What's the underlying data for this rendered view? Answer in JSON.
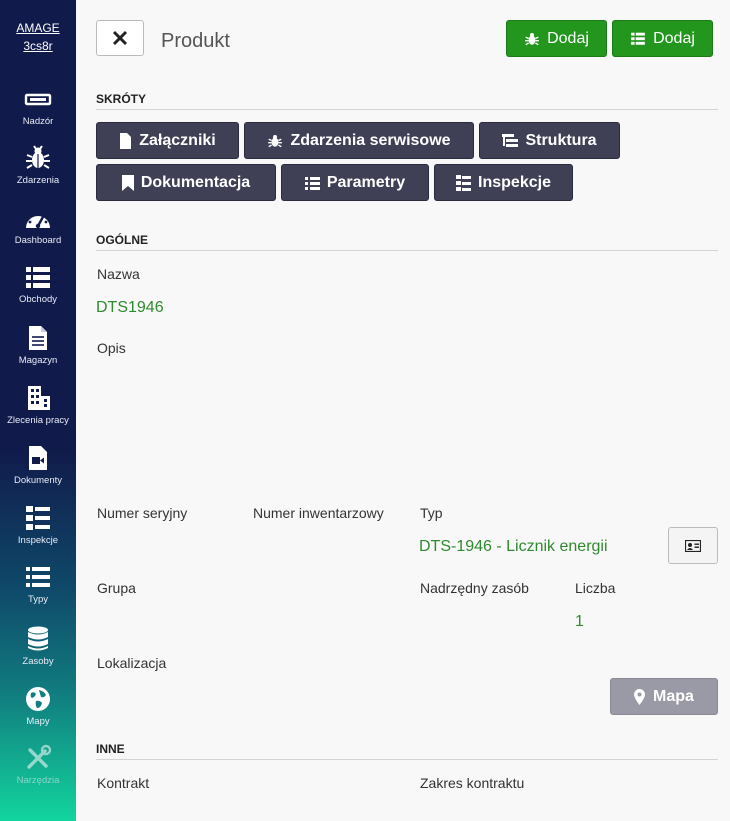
{
  "sidebar": {
    "brand_line1": "AMAGE",
    "brand_line2": "3cs8r",
    "items": [
      {
        "label": "Nadzór",
        "icon": "monitor-icon"
      },
      {
        "label": "Zdarzenia",
        "icon": "bug-icon"
      },
      {
        "label": "Dashboard",
        "icon": "gauge-icon"
      },
      {
        "label": "Obchody",
        "icon": "list-icon"
      },
      {
        "label": "Magazyn",
        "icon": "document-icon"
      },
      {
        "label": "Zlecenia pracy",
        "icon": "building-icon"
      },
      {
        "label": "Dokumenty",
        "icon": "video-file-icon"
      },
      {
        "label": "Inspekcje",
        "icon": "checklist-icon"
      },
      {
        "label": "Typy",
        "icon": "list-icon"
      },
      {
        "label": "Zasoby",
        "icon": "database-icon"
      },
      {
        "label": "Mapy",
        "icon": "globe-icon"
      },
      {
        "label": "Narzędzia",
        "icon": "tools-icon"
      }
    ]
  },
  "header": {
    "title": "Produkt",
    "add_event_label": "Dodaj",
    "add_list_label": "Dodaj"
  },
  "shortcuts": {
    "title": "SKRÓTY",
    "buttons": [
      {
        "label": "Załączniki",
        "icon": "file-icon"
      },
      {
        "label": "Zdarzenia serwisowe",
        "icon": "bug-icon"
      },
      {
        "label": "Struktura",
        "icon": "structure-icon"
      },
      {
        "label": "Dokumentacja",
        "icon": "bookmark-icon"
      },
      {
        "label": "Parametry",
        "icon": "list-icon"
      },
      {
        "label": "Inspekcje",
        "icon": "checklist-icon"
      }
    ]
  },
  "general": {
    "title": "OGÓLNE",
    "name_label": "Nazwa",
    "name_value": "DTS1946",
    "description_label": "Opis",
    "serial_label": "Numer seryjny",
    "inventory_label": "Numer inwentarzowy",
    "type_label": "Typ",
    "type_value": "DTS-1946 - Licznik energii",
    "group_label": "Grupa",
    "parent_label": "Nadrzędny zasób",
    "count_label": "Liczba",
    "count_value": "1",
    "location_label": "Lokalizacja",
    "map_label": "Mapa"
  },
  "other": {
    "title": "INNE",
    "contract_label": "Kontrakt",
    "contract_scope_label": "Zakres kontraktu"
  },
  "colors": {
    "sidebar_bg": "#101b4c",
    "green_button": "#23961e",
    "shortcut_button": "#3f4056",
    "value_green": "#2e8b2e",
    "map_button": "#9a9aa6"
  }
}
